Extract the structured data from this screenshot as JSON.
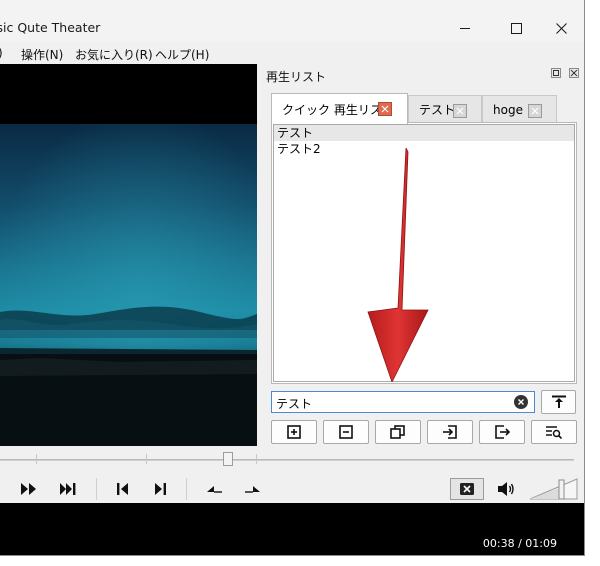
{
  "window": {
    "title": "ssic Qute Theater"
  },
  "menu": [
    ")",
    "操作(N)",
    "お気に入り(R)",
    "ヘルプ(H)"
  ],
  "playlist": {
    "title": "再生リスト",
    "tabs": [
      {
        "label": "クイック 再生リスト",
        "active": true
      },
      {
        "label": "テスト",
        "active": false
      },
      {
        "label": "hoge",
        "active": false
      }
    ],
    "items": [
      "テスト",
      "テスト2"
    ],
    "search_value": "テスト"
  },
  "time": {
    "current": "00:38",
    "separator": "/",
    "total": "01:09"
  },
  "colors": {
    "accent_arrow": "#d42a2a",
    "active_tab_close": "#e06a50",
    "search_border": "#4a8ad0"
  },
  "icons": {
    "playlist_buttons": [
      "add-icon",
      "remove-icon",
      "copy-icon",
      "import-icon",
      "export-icon",
      "find-icon"
    ],
    "search_action": "move-top-icon",
    "playback": [
      "fast-forward-icon",
      "skip-next-icon",
      "step-back-icon",
      "step-forward-icon",
      "frame-back-icon",
      "frame-forward-icon",
      "mute-toggle-icon",
      "speaker-icon"
    ]
  }
}
